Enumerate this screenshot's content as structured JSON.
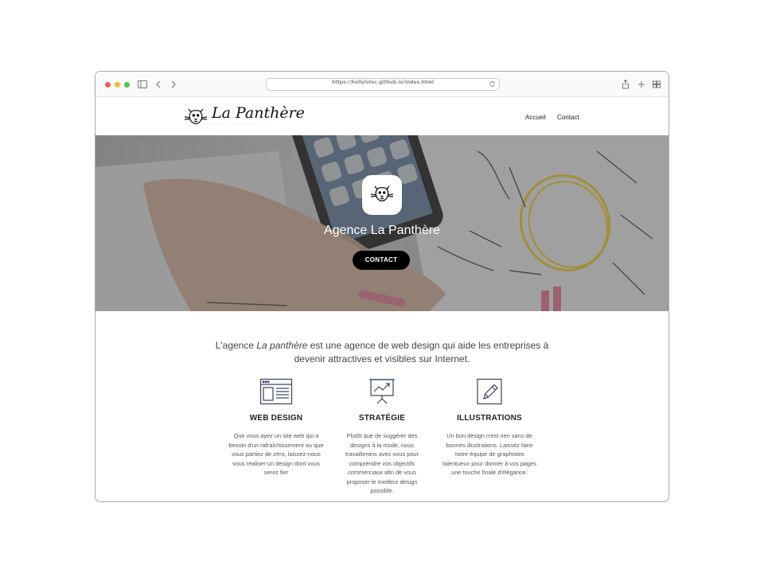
{
  "browser": {
    "url": "https://hollyloloc.github.io/index.html",
    "icons": [
      "sidebar-icon",
      "back-icon",
      "forward-icon",
      "reload-icon",
      "share-icon",
      "new-tab-icon",
      "tabs-overview-icon"
    ]
  },
  "header": {
    "logo_text": "La Panthère",
    "nav": [
      {
        "label": "Accueil"
      },
      {
        "label": "Contact"
      }
    ]
  },
  "hero": {
    "title": "Agence La Panthère",
    "button_label": "CONTACT"
  },
  "intro": {
    "before": "L'agence ",
    "emphasis": "La panthère",
    "after": " est une agence de web design qui aide les entreprises à devenir attractives et visibles sur Internet."
  },
  "services": [
    {
      "title": "WEB DESIGN",
      "icon": "web-layout-icon",
      "text": "Que vous ayez un site web qui a besoin d'un rafraîchissement ou que vous partiez de zéro, laissez-nous vous réaliser un design dont vous serez fier"
    },
    {
      "title": "STRATÉGIE",
      "icon": "presentation-chart-icon",
      "text": "Plutôt que de suggérer des designs à la mode, nous travaillerons avec vous pour comprendre vos objectifs commerciaux afin de vous proposer le meilleur design possible."
    },
    {
      "title": "ILLUSTRATIONS",
      "icon": "pencil-icon",
      "text": "Un bon design n'est rien sans de bonnes illustrations. Laissez faire notre équipe de graphistes talentueux pour donner à vos pages une touche finale d'élégance."
    }
  ],
  "colors": {
    "accent": "#000000",
    "icon": "#3a4060",
    "traffic_red": "#ee5d56",
    "traffic_yellow": "#f5b73a",
    "traffic_green": "#4fc24a"
  }
}
